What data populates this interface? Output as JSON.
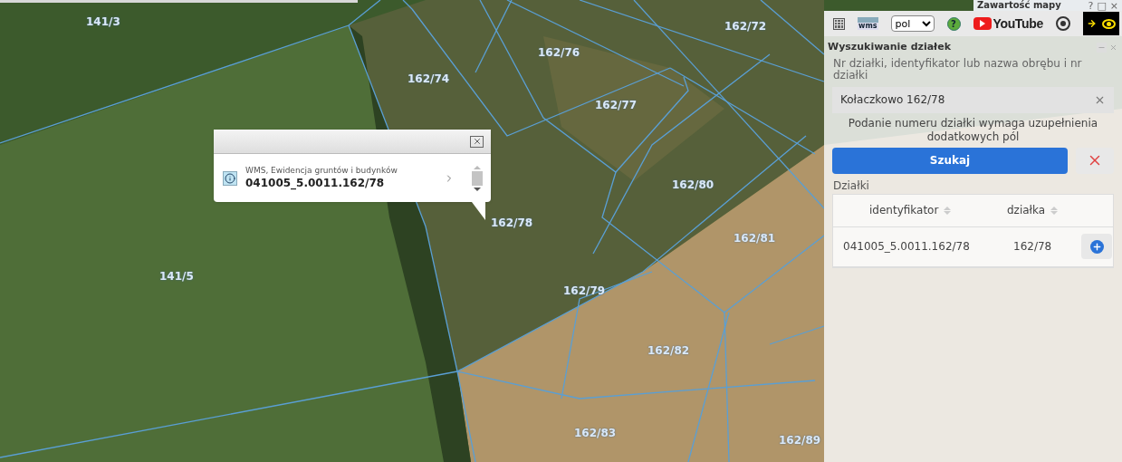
{
  "map": {
    "parcel_labels": [
      "141/3",
      "162/74",
      "162/76",
      "162/77",
      "162/72",
      "162/80",
      "162/78",
      "162/81",
      "141/5",
      "162/79",
      "162/82",
      "162/83",
      "162/89"
    ]
  },
  "layer_panel_header": {
    "title": "Zawartość mapy",
    "buttons": [
      "?",
      "□",
      "×"
    ]
  },
  "toolbar": {
    "wms_label": "wms",
    "language": "pol",
    "help": "?",
    "youtube": "YouTube"
  },
  "popup": {
    "layer": "WMS, Ewidencja gruntów i budynków",
    "identifier": "041005_5.0011.162/78"
  },
  "search_panel": {
    "title": "Wyszukiwanie działek",
    "field_label": "Nr działki, identyfikator lub nazwa obrębu i nr działki",
    "field_value": "Kołaczkowo 162/78",
    "message": "Podanie numeru działki wymaga uzupełnienia dodatkowych pól",
    "search_button": "Szukaj",
    "results_label": "Działki",
    "table": {
      "columns": [
        "identyfikator",
        "działka"
      ],
      "rows": [
        {
          "identifier": "041005_5.0011.162/78",
          "parcel": "162/78"
        }
      ]
    }
  }
}
